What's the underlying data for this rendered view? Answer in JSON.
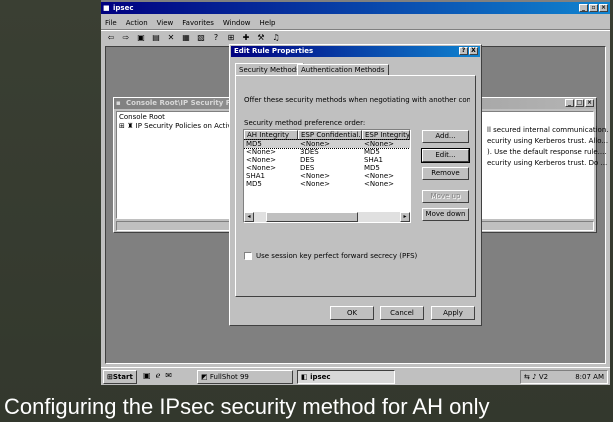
{
  "caption": "Configuring the IPsec security method for AH only",
  "main_window": {
    "title": "ipsec",
    "menu": [
      "File",
      "Action",
      "View",
      "Favorites",
      "Window",
      "Help"
    ]
  },
  "console_window": {
    "title": "Console Root\\IP Security Policies on Active Directory",
    "tree": [
      "Console Root",
      "IP Security Policies on Active"
    ],
    "right_lines": [
      "ll secured internal communication.",
      "ecurity using Kerberos trust. Allo...",
      "). Use the default response rule....",
      "ecurity using Kerberos trust. Do ..."
    ]
  },
  "dialog": {
    "title": "Edit Rule Properties",
    "help": "?",
    "close": "X",
    "tabs": [
      "Security Methods",
      "Authentication Methods"
    ],
    "description": "Offer these security methods when negotiating with another computer.",
    "list_label": "Security method preference order:",
    "columns": [
      "AH Integrity",
      "ESP Confidential...",
      "ESP Integrity"
    ],
    "rows": [
      [
        "MD5",
        "<None>",
        "<None>"
      ],
      [
        "<None>",
        "3DES",
        "MD5"
      ],
      [
        "<None>",
        "DES",
        "SHA1"
      ],
      [
        "<None>",
        "DES",
        "MD5"
      ],
      [
        "SHA1",
        "<None>",
        "<None>"
      ],
      [
        "MD5",
        "<None>",
        "<None>"
      ]
    ],
    "buttons": {
      "add": "Add...",
      "edit": "Edit...",
      "remove": "Remove",
      "move_up": "Move up",
      "move_down": "Move down"
    },
    "pfs_label": "Use session key perfect forward secrecy (PFS)",
    "pfs_checked": false,
    "ok": "OK",
    "cancel": "Cancel",
    "apply": "Apply"
  },
  "taskbar": {
    "start": "Start",
    "items": [
      "FullShot 99",
      "ipsec"
    ],
    "tray_label": "V2",
    "clock": "8:07 AM"
  },
  "colors": {
    "title_active": "#000080",
    "selection": "#000080",
    "desktop": "#808080",
    "face": "#c0c0c0"
  }
}
